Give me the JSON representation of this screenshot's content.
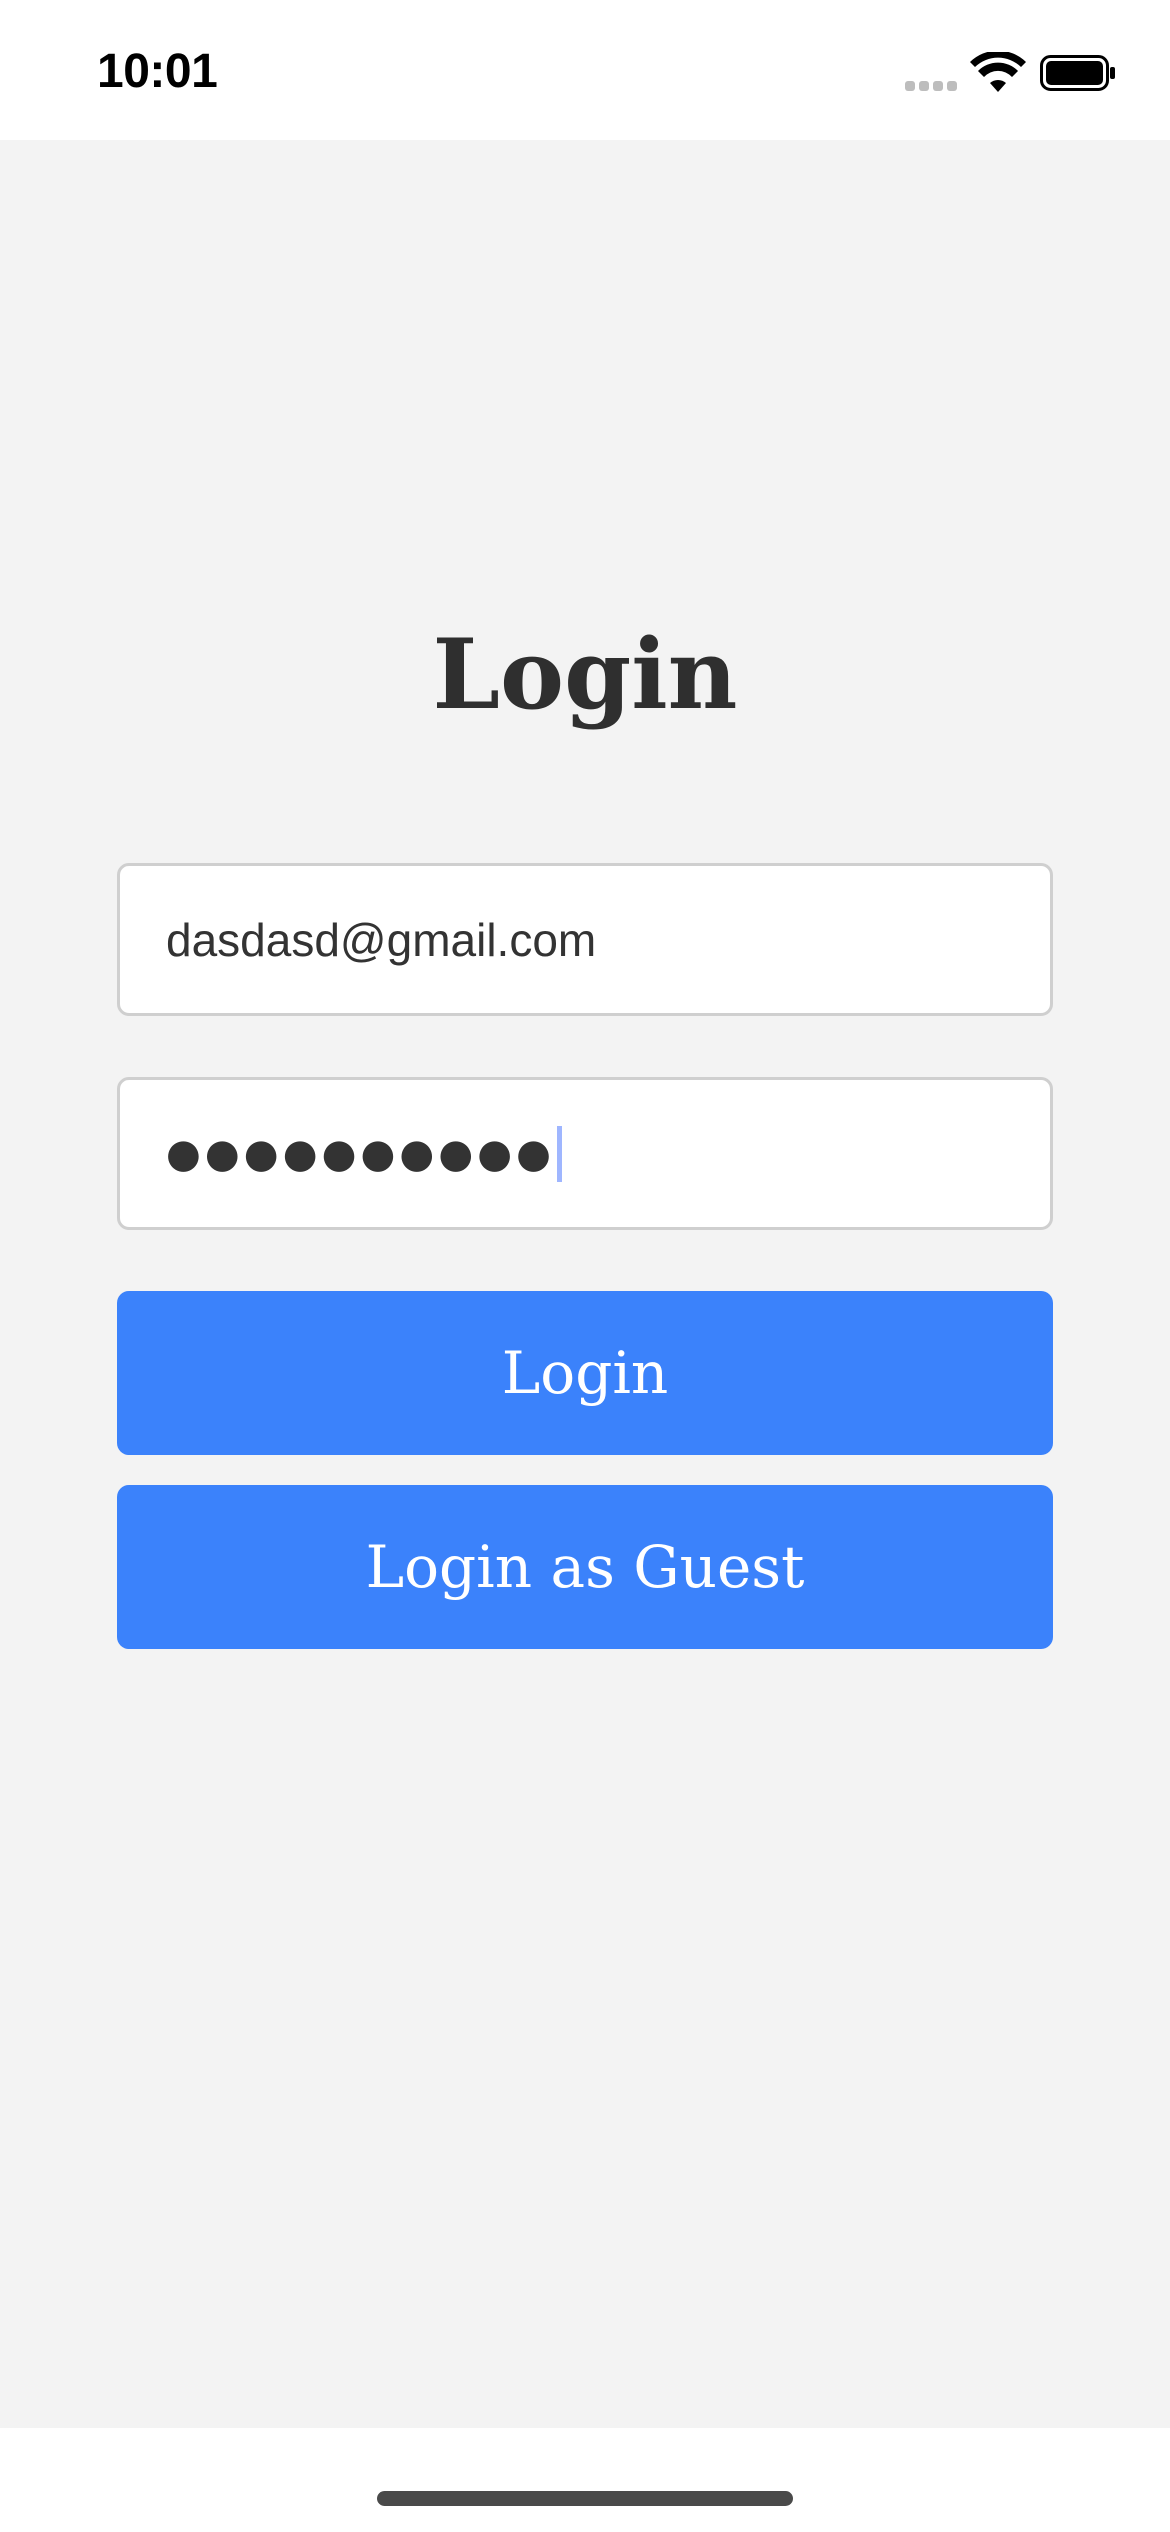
{
  "status_bar": {
    "time": "10:01"
  },
  "login": {
    "title": "Login",
    "email_value": "dasdasd@gmail.com",
    "password_masked": "●●●●●●●●●●",
    "login_button_label": "Login",
    "guest_button_label": "Login as Guest"
  },
  "colors": {
    "background": "#f3f3f3",
    "button": "#3b82fb",
    "title": "#2f2f2f",
    "field_border": "#cfcfcf"
  },
  "icons": {
    "signal": "signal-icon",
    "wifi": "wifi-icon",
    "battery": "battery-icon"
  }
}
